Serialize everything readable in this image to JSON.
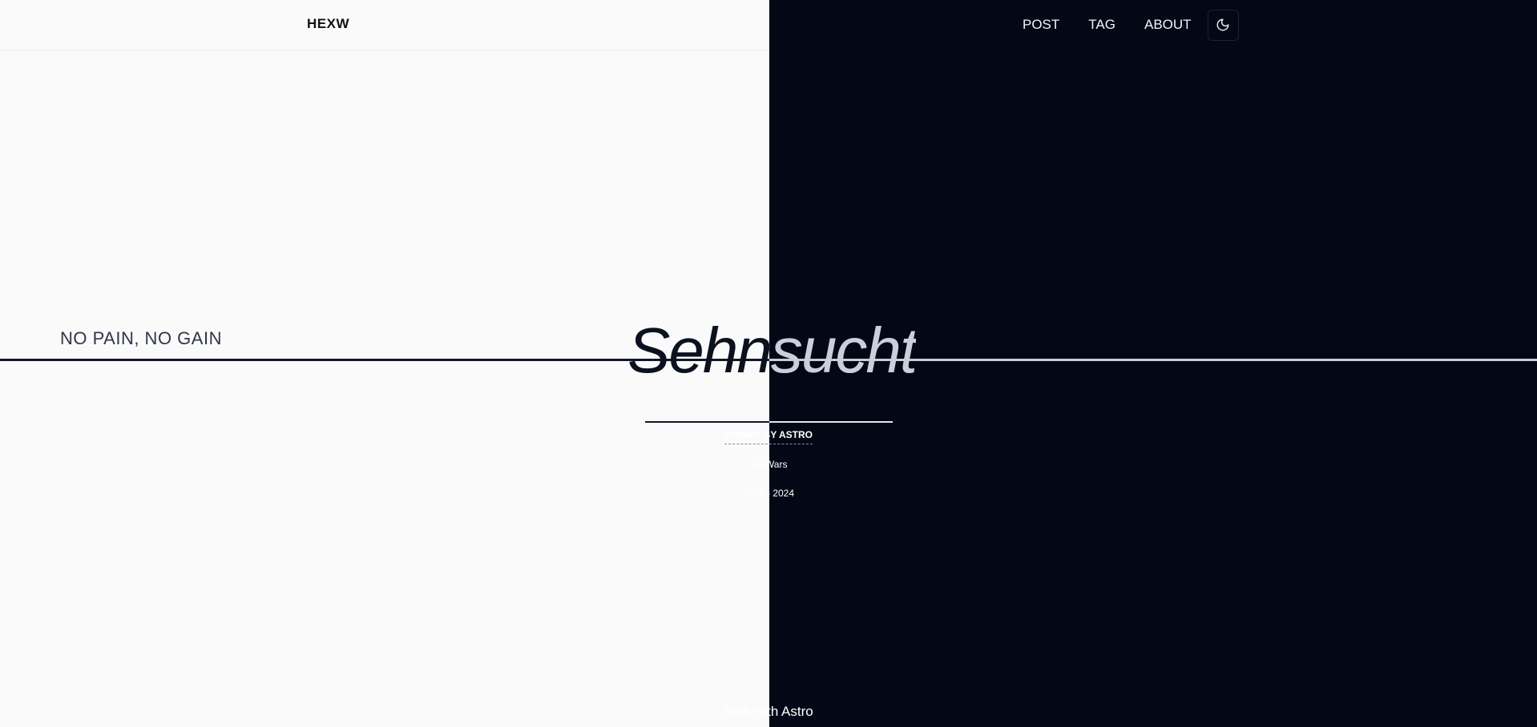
{
  "header": {
    "brand": "HEXW",
    "nav": [
      "POST",
      "TAG",
      "ABOUT"
    ],
    "theme_toggle_icon": "moon-icon"
  },
  "hero": {
    "motto": "NO PAIN, NO GAIN",
    "title": "Sehnsucht",
    "power": "POWER BY ASTRO",
    "author": "hexWars",
    "years": "2020 - 2024"
  },
  "footer": {
    "text": "Built with Astro"
  },
  "colors": {
    "left_bg": "#fafafa",
    "right_bg": "#030816",
    "dark_text": "#0c1120",
    "light_text": "#c9d0dc"
  }
}
